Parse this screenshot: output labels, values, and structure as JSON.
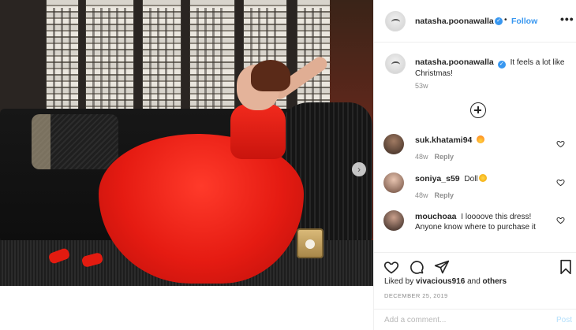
{
  "post": {
    "author": "natasha.poonawalla",
    "follow_label": "Follow",
    "separator": "•",
    "more_label": "•••",
    "caption": "It feels a lot like Christmas!",
    "caption_age": "53w",
    "verified_glyph": "✓"
  },
  "comments": [
    {
      "user": "suk.khatami94",
      "text": "",
      "emoji": "fire",
      "age": "48w",
      "reply_label": "Reply"
    },
    {
      "user": "soniya_s59",
      "text": "Doll",
      "emoji": "heart-eyes",
      "age": "48w",
      "reply_label": "Reply"
    },
    {
      "user": "mouchoaa",
      "text": "I loooove this dress! Anyone know where to purchase it",
      "emoji": "",
      "age": "",
      "reply_label": ""
    }
  ],
  "likes": {
    "prefix": "Liked by",
    "user": "vivacious916",
    "joiner": "and",
    "others": "others"
  },
  "date": "DECEMBER 25, 2019",
  "add_comment": {
    "placeholder": "Add a comment...",
    "post_label": "Post"
  },
  "photo": {
    "next_glyph": "›"
  },
  "colors": {
    "link": "#3897f0",
    "muted": "#8e8e8e",
    "dress": "#e51b12"
  },
  "icons": [
    "heart-icon",
    "comment-icon",
    "share-icon",
    "bookmark-icon",
    "add-circle-icon",
    "verified-icon",
    "more-options-icon",
    "chevron-right-icon"
  ]
}
